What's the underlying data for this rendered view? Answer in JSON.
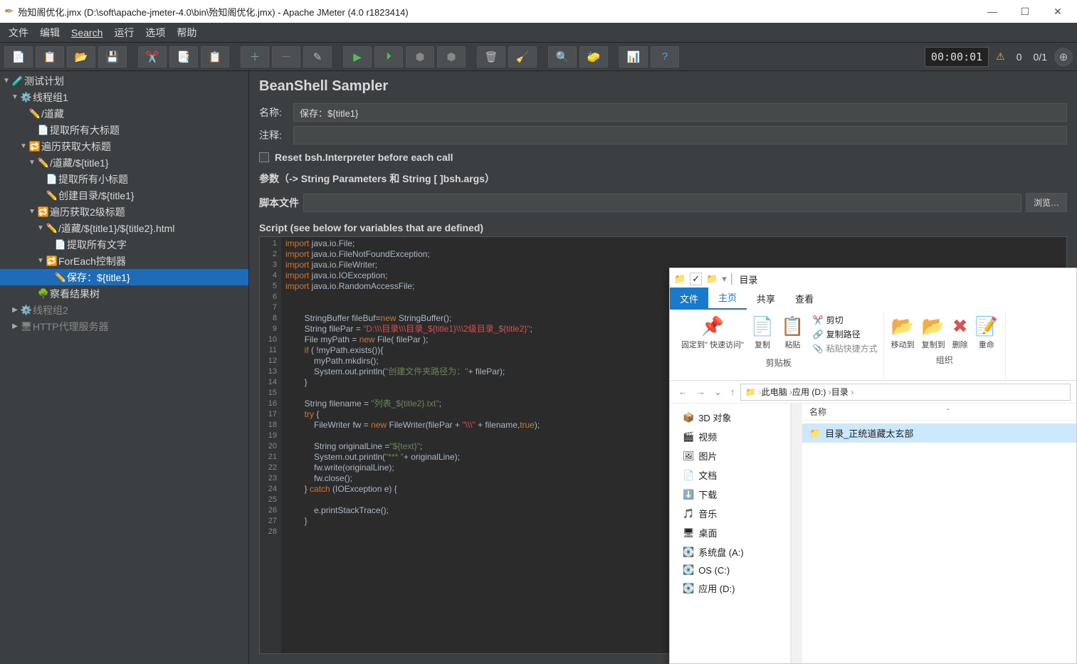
{
  "window": {
    "title": "殆知阁优化.jmx (D:\\soft\\apache-jmeter-4.0\\bin\\殆知阁优化.jmx) - Apache JMeter (4.0 r1823414)"
  },
  "menu": [
    "文件",
    "编辑",
    "Search",
    "运行",
    "选项",
    "帮助"
  ],
  "toolbar": {
    "time": "00:00:01",
    "warn_count": "0",
    "thread_count": "0/1"
  },
  "tree": [
    {
      "lvl": 0,
      "tw": "▼",
      "ic": "flask",
      "txt": "测试计划"
    },
    {
      "lvl": 1,
      "tw": "▼",
      "ic": "gear",
      "txt": "线程组1"
    },
    {
      "lvl": 2,
      "tw": "",
      "ic": "pen",
      "txt": "/道藏"
    },
    {
      "lvl": 3,
      "tw": "",
      "ic": "doc",
      "txt": "提取所有大标题"
    },
    {
      "lvl": 2,
      "tw": "▼",
      "ic": "loop",
      "txt": "遍历获取大标题"
    },
    {
      "lvl": 3,
      "tw": "▼",
      "ic": "pen",
      "txt": "/道藏/${title1}"
    },
    {
      "lvl": 4,
      "tw": "",
      "ic": "doc",
      "txt": "提取所有小标题"
    },
    {
      "lvl": 4,
      "tw": "",
      "ic": "pen",
      "txt": "创建目录/${title1}"
    },
    {
      "lvl": 3,
      "tw": "▼",
      "ic": "loop",
      "txt": "遍历获取2级标题"
    },
    {
      "lvl": 4,
      "tw": "▼",
      "ic": "pen",
      "txt": "/道藏/${title1}/${title2}.html"
    },
    {
      "lvl": 5,
      "tw": "",
      "ic": "doc",
      "txt": "提取所有文字"
    },
    {
      "lvl": 4,
      "tw": "▼",
      "ic": "loop",
      "txt": "ForEach控制器"
    },
    {
      "lvl": 5,
      "tw": "",
      "ic": "pen",
      "txt": "保存：${title1}",
      "sel": true
    },
    {
      "lvl": 3,
      "tw": "",
      "ic": "tree",
      "txt": "察看结果树"
    },
    {
      "lvl": 1,
      "tw": "▶",
      "ic": "gear",
      "txt": "线程组2",
      "dim": true
    },
    {
      "lvl": 1,
      "tw": "▶",
      "ic": "srv",
      "txt": "HTTP代理服务器",
      "dim": true
    }
  ],
  "panel": {
    "heading": "BeanShell Sampler",
    "name_label": "名称:",
    "name_value": "保存：${title1}",
    "comment_label": "注释:",
    "reset_label": "Reset bsh.Interpreter before each call",
    "params_label": "参数（-> String Parameters 和 String [ ]bsh.args）",
    "scriptfile_label": "脚本文件",
    "browse_label": "浏览…",
    "script_header": "Script (see below for variables that are defined)"
  },
  "code_lines": 28,
  "explorer": {
    "title": "目录",
    "tabs": {
      "file": "文件",
      "home": "主页",
      "share": "共享",
      "view": "查看"
    },
    "ribbon": {
      "pin": "固定到\"\n快速访问\"",
      "copy": "复制",
      "paste": "粘贴",
      "cut": "剪切",
      "copypath": "复制路径",
      "pasteshort": "粘贴快捷方式",
      "group1": "剪贴板",
      "moveto": "移动到",
      "copyto": "复制到",
      "delete": "删除",
      "rename": "重命",
      "group2": "组织"
    },
    "breadcrumb": [
      "此电脑",
      "应用 (D:)",
      "目录"
    ],
    "col_name": "名称",
    "nav": [
      "3D 对象",
      "视频",
      "图片",
      "文档",
      "下载",
      "音乐",
      "桌面",
      "系统盘 (A:)",
      "OS (C:)",
      "应用 (D:)"
    ],
    "file": "目录_正统道藏太玄部"
  }
}
